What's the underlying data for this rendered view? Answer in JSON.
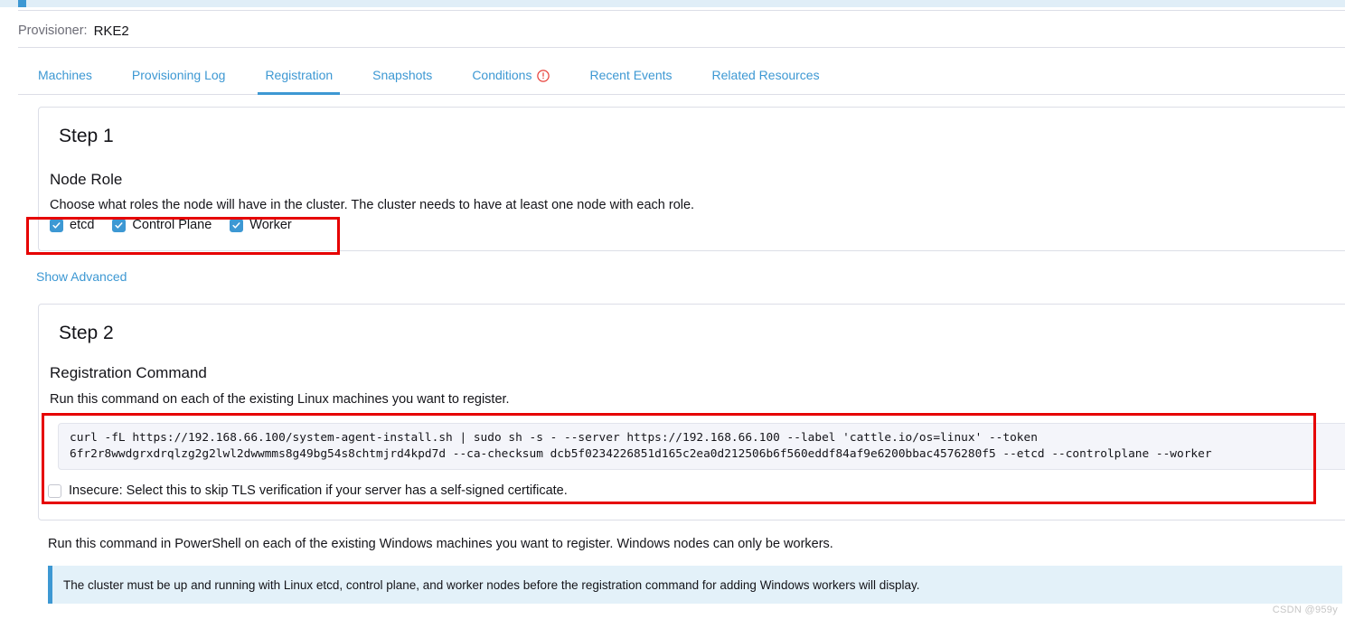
{
  "header": {
    "provisioner_label": "Provisioner:",
    "provisioner_value": "RKE2"
  },
  "tabs": [
    {
      "label": "Machines",
      "active": false,
      "icon": null
    },
    {
      "label": "Provisioning Log",
      "active": false,
      "icon": null
    },
    {
      "label": "Registration",
      "active": true,
      "icon": null
    },
    {
      "label": "Snapshots",
      "active": false,
      "icon": null
    },
    {
      "label": "Conditions",
      "active": false,
      "icon": "warning-circle-icon"
    },
    {
      "label": "Recent Events",
      "active": false,
      "icon": null
    },
    {
      "label": "Related Resources",
      "active": false,
      "icon": null
    }
  ],
  "step1": {
    "title": "Step 1",
    "heading": "Node Role",
    "description": "Choose what roles the node will have in the cluster. The cluster needs to have at least one node with each role.",
    "roles": [
      {
        "label": "etcd",
        "checked": true
      },
      {
        "label": "Control Plane",
        "checked": true
      },
      {
        "label": "Worker",
        "checked": true
      }
    ]
  },
  "show_advanced_label": "Show Advanced",
  "step2": {
    "title": "Step 2",
    "heading": "Registration Command",
    "linux_instruction": "Run this command on each of the existing Linux machines you want to register.",
    "command_line_1": "curl -fL https://192.168.66.100/system-agent-install.sh | sudo sh -s - --server https://192.168.66.100 --label 'cattle.io/os=linux' --token",
    "command_line_2": "6fr2r8wwdgrxdrqlzg2g2lwl2dwwmms8g49bg54s8chtmjrd4kpd7d --ca-checksum dcb5f0234226851d165c2ea0d212506b6f560eddf84af9e6200bbac4576280f5 --etcd --controlplane --worker",
    "insecure": {
      "label": "Insecure: Select this to skip TLS verification if your server has a self-signed certificate.",
      "checked": false
    },
    "windows_instruction": "Run this command in PowerShell on each of the existing Windows machines you want to register. Windows nodes can only be workers.",
    "info_banner": "The cluster must be up and running with Linux etcd, control plane, and worker nodes before the registration command for adding Windows workers will display."
  },
  "annotations": {
    "roles_box": "highlight-node-roles",
    "command_box": "highlight-registration-command"
  },
  "watermark": "CSDN @959y",
  "colors": {
    "accent": "#3d98d3",
    "warning": "#e60000",
    "annotation": "#e60000",
    "banner_bg": "#e3f1f9",
    "code_bg": "#f4f5fa"
  }
}
